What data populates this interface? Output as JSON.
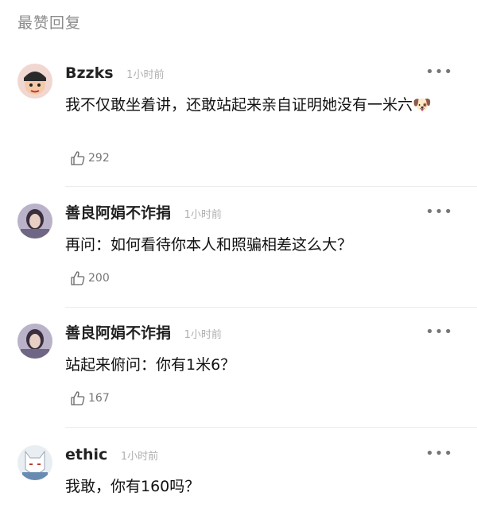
{
  "section": {
    "title": "最赞回复"
  },
  "comments": [
    {
      "user": "Bzzks",
      "time": "1小时前",
      "text": "我不仅敢坐着讲，还敢站起来亲自证明她没有一米六",
      "emoji": "🐶",
      "likes": "292"
    },
    {
      "user": "善良阿娟不诈捐",
      "time": "1小时前",
      "text": "再问：如何看待你本人和照骗相差这么大？",
      "likes": "200"
    },
    {
      "user": "善良阿娟不诈捐",
      "time": "1小时前",
      "text": "站起来俯问：你有1米6？",
      "likes": "167"
    },
    {
      "user": "ethic",
      "time": "1小时前",
      "text": "我敢，你有160吗？",
      "likes": ""
    }
  ],
  "icons": {
    "more": "more-icon",
    "like": "thumbs-up-icon"
  },
  "more_glyph": "•••"
}
